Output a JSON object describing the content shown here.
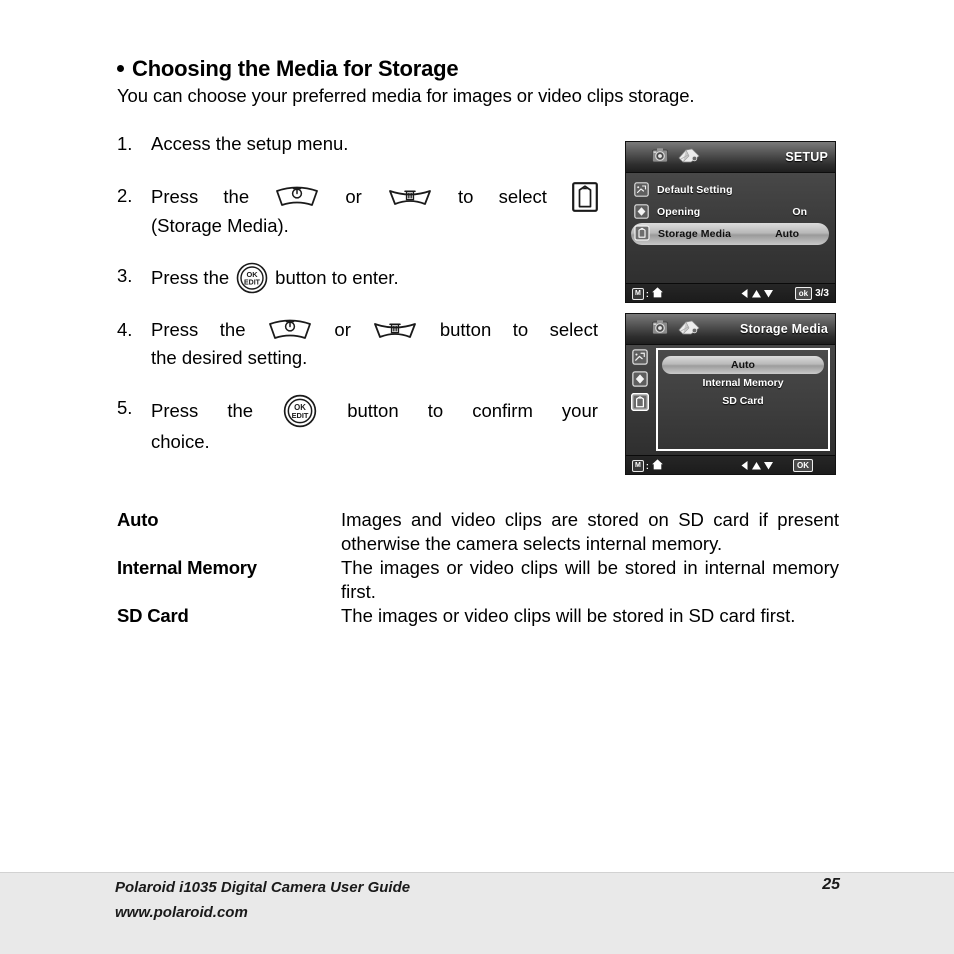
{
  "document": {
    "heading": "Choosing the Media for Storage",
    "intro": "You can choose your preferred media for images or video clips storage."
  },
  "steps": [
    {
      "num": "1.",
      "parts": [
        "Access the setup menu."
      ]
    },
    {
      "num": "2.",
      "line1_a": "Press",
      "line1_b": "the",
      "line1_or": "or",
      "line1_c": "to",
      "line1_d": "select",
      "line2": "(Storage Media)."
    },
    {
      "num": "3.",
      "line1_a": "Press the",
      "line1_b": "button to enter."
    },
    {
      "num": "4.",
      "line1_a": "Press",
      "line1_b": "the",
      "line1_or": "or",
      "line1_c": "button",
      "line1_d": "to",
      "line1_e": "select",
      "line2": "the desired setting."
    },
    {
      "num": "5.",
      "line1_a": "Press",
      "line1_b": "the",
      "line1_c": "button",
      "line1_d": "to",
      "line1_e": "confirm",
      "line1_f": "your",
      "line2": "choice."
    }
  ],
  "buttons": {
    "ok_edit_top": "OK",
    "ok_edit_bottom": "EDIT"
  },
  "definitions": [
    {
      "term": "Auto",
      "desc": "Images and video clips are stored on SD card if present otherwise the camera selects internal memory."
    },
    {
      "term": "Internal Memory",
      "desc": "The images or video clips will be stored in internal memory first."
    },
    {
      "term": "SD Card",
      "desc": "The images or video clips will be stored in SD card first."
    }
  ],
  "screens": [
    {
      "id": "setup",
      "title": "SETUP",
      "menu": [
        {
          "icon": "default-setting-icon",
          "label": "Default Setting",
          "value": "",
          "selected": false
        },
        {
          "icon": "opening-icon",
          "label": "Opening",
          "value": "On",
          "selected": false
        },
        {
          "icon": "storage-media-icon",
          "label": "Storage Media",
          "value": "Auto",
          "selected": true
        }
      ],
      "footer": {
        "mode_badge": "M",
        "separator": ":",
        "home_icon": "home-icon",
        "nav_icons": "left-up-down-arrows",
        "ok_badge": "ok",
        "page_count": "3/3"
      }
    },
    {
      "id": "storage-media",
      "title": "Storage Media",
      "sidebar": [
        "default-setting-icon",
        "opening-icon",
        "storage-media-icon"
      ],
      "options": [
        {
          "label": "Auto",
          "selected": true
        },
        {
          "label": "Internal Memory",
          "selected": false
        },
        {
          "label": "SD Card",
          "selected": false
        }
      ],
      "footer": {
        "mode_badge": "M",
        "separator": ":",
        "home_icon": "home-icon",
        "nav_icons": "left-up-down-arrows",
        "ok_badge": "OK",
        "page_count": ""
      }
    }
  ],
  "footer": {
    "line1": "Polaroid i1035 Digital Camera User Guide",
    "line2": "www.polaroid.com",
    "page_number": "25"
  },
  "colors": {
    "page_bg": "#ffffff",
    "text": "#000000",
    "footer_band": "#e9e9e9",
    "screen_bg": "#2b2b2b",
    "highlight": "#c8c8c8"
  }
}
